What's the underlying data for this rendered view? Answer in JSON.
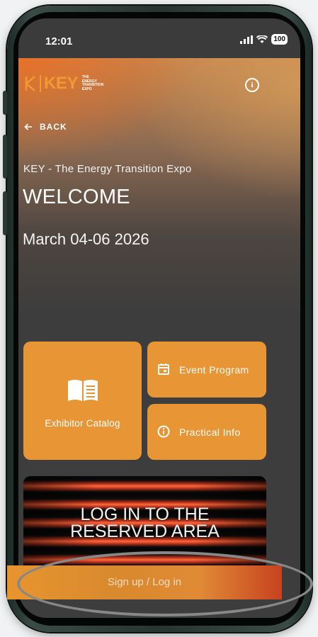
{
  "status_bar": {
    "time": "12:01",
    "battery": "100"
  },
  "header": {
    "logo_main": "K|KEY",
    "logo_sub_lines": [
      "THE",
      "ENERGY",
      "TRANSITION",
      "EXPO"
    ]
  },
  "nav": {
    "back_label": "BACK"
  },
  "hero": {
    "subtitle": "KEY - The Energy Transition Expo",
    "title": "WELCOME",
    "dates": "March 04-06 2026"
  },
  "tiles": {
    "exhibitor_catalog": "Exhibitor Catalog",
    "event_program": "Event Program",
    "practical_info": "Practical Info"
  },
  "promo": {
    "line1": "LOG IN TO THE",
    "line2": "RESERVED AREA"
  },
  "cta": {
    "signup_login": "Sign up / Log in"
  },
  "colors": {
    "accent": "#e89535",
    "logo": "#f19a33",
    "background": "#3d3d3d"
  },
  "icons": [
    "info-icon",
    "back-arrow-icon",
    "book-icon",
    "calendar-icon",
    "signal-icon",
    "wifi-icon",
    "battery-icon"
  ]
}
